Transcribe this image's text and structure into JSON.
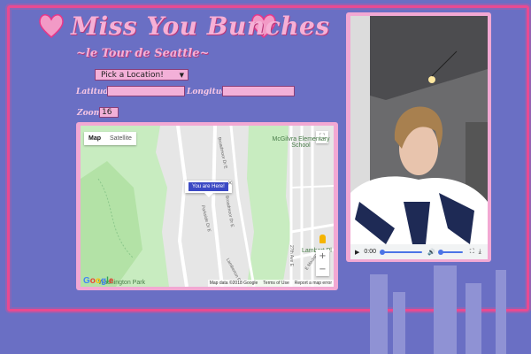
{
  "header": {
    "title": "Miss You Bunches",
    "subtitle": "~le Tour de Seattle~"
  },
  "form": {
    "location_select": {
      "value": "Pick a Location!"
    },
    "latitude": {
      "label": "Latitude:",
      "value": ""
    },
    "longitude": {
      "label": "Longitude:",
      "value": ""
    },
    "zoom": {
      "label": "Zoom:",
      "value": "16"
    }
  },
  "map": {
    "map_type": {
      "map": "Map",
      "satellite": "Satellite",
      "selected": "Map"
    },
    "info_window": {
      "label": "You are Here!"
    },
    "pois": {
      "school": "McGilvra Elementary School",
      "lambert": "Lambert Pl",
      "park": "Washington Park"
    },
    "roads": {
      "r1": "Broadmoor Dr E",
      "r2": "Parkside Dr E",
      "r3": "Broadmoor Dr E",
      "r4": "27th Ave E",
      "r5": "E Madison",
      "r6": "Lamberton P"
    },
    "logo": "Google",
    "attribution": {
      "data": "Map data ©2018 Google",
      "terms": "Terms of Use",
      "report": "Report a map error"
    },
    "zoom_in": "+",
    "zoom_out": "−"
  },
  "video": {
    "current_time": "0:00",
    "progress_fraction": 0.0,
    "volume_fraction": 0.5
  },
  "colors": {
    "background": "#6a6fc4",
    "accent_pink": "#e94a91",
    "title_pink": "#f6b0d6",
    "input_pink": "#f3b0d8"
  },
  "icons": {
    "heart": "heart-icon",
    "play": "play-icon",
    "volume": "volume-icon",
    "fullscreen": "fullscreen-icon",
    "download": "download-icon"
  }
}
